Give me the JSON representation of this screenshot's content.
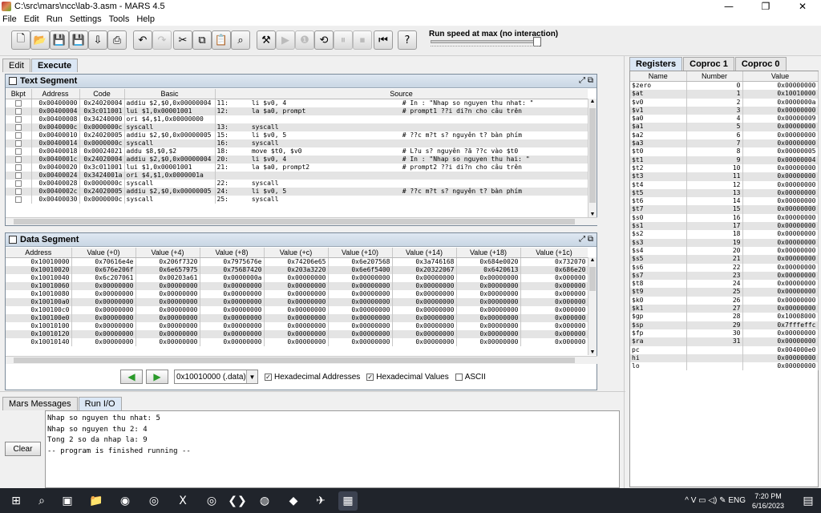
{
  "window": {
    "title": "C:\\src\\mars\\ncc\\lab-3.asm  - MARS 4.5",
    "minimize": "—",
    "maximize": "❐",
    "close": "✕"
  },
  "menu": [
    "File",
    "Edit",
    "Run",
    "Settings",
    "Tools",
    "Help"
  ],
  "toolbar": {
    "buttons": [
      {
        "name": "new-file-icon",
        "glyph": "🗋",
        "enabled": true
      },
      {
        "name": "open-file-icon",
        "glyph": "📂",
        "enabled": true
      },
      {
        "name": "save-file-icon",
        "glyph": "💾",
        "enabled": true
      },
      {
        "name": "save-as-icon",
        "glyph": "💾",
        "enabled": true
      },
      {
        "name": "dump-memory-icon",
        "glyph": "⇩",
        "enabled": true
      },
      {
        "name": "print-icon",
        "glyph": "⎙",
        "enabled": true
      },
      {
        "name": "undo-icon",
        "glyph": "↶",
        "enabled": true
      },
      {
        "name": "redo-icon",
        "glyph": "↷",
        "enabled": false
      },
      {
        "name": "cut-icon",
        "glyph": "✂",
        "enabled": true
      },
      {
        "name": "copy-icon",
        "glyph": "⧉",
        "enabled": true
      },
      {
        "name": "paste-icon",
        "glyph": "📋",
        "enabled": true
      },
      {
        "name": "find-replace-icon",
        "glyph": "⌕",
        "enabled": true
      },
      {
        "name": "assemble-icon",
        "glyph": "⚒",
        "enabled": true
      },
      {
        "name": "run-icon",
        "glyph": "▶",
        "enabled": false
      },
      {
        "name": "step-icon",
        "glyph": "❶",
        "enabled": false
      },
      {
        "name": "backstep-icon",
        "glyph": "⟲",
        "enabled": true
      },
      {
        "name": "pause-icon",
        "glyph": "⏸",
        "enabled": false
      },
      {
        "name": "stop-icon",
        "glyph": "⏹",
        "enabled": false
      },
      {
        "name": "reset-icon",
        "glyph": "⏮",
        "enabled": true
      },
      {
        "name": "help-icon",
        "glyph": "?",
        "enabled": true
      }
    ],
    "speed_label": "Run speed at max (no interaction)"
  },
  "main_tabs": [
    "Edit",
    "Execute"
  ],
  "text_segment": {
    "title": "Text Segment",
    "columns": [
      "Bkpt",
      "Address",
      "Code",
      "Basic",
      "Source"
    ],
    "rows": [
      [
        "0x00400000",
        "0x24020004",
        "addiu $2,$0,0x00000004",
        "11:      li $v0, 4                              # In : \"Nhap so nguyen thu nhat: \""
      ],
      [
        "0x00400004",
        "0x3c011001",
        "lui $1,0x00001001",
        "12:      la $a0, prompt                         # prompt1 ??i di?n cho câu trên"
      ],
      [
        "0x00400008",
        "0x34240000",
        "ori $4,$1,0x00000000",
        ""
      ],
      [
        "0x0040000c",
        "0x0000000c",
        "syscall",
        "13:      syscall"
      ],
      [
        "0x00400010",
        "0x24020005",
        "addiu $2,$0,0x00000005",
        "15:      li $v0, 5                              # ??c m?t s? nguyên t? bàn phím"
      ],
      [
        "0x00400014",
        "0x0000000c",
        "syscall",
        "16:      syscall"
      ],
      [
        "0x00400018",
        "0x00024021",
        "addu $8,$0,$2",
        "18:      move $t0, $v0                          # L?u s? nguyên ?ã ??c vào $t0"
      ],
      [
        "0x0040001c",
        "0x24020004",
        "addiu $2,$0,0x00000004",
        "20:      li $v0, 4                              # In : \"Nhap so nguyen thu hai: \""
      ],
      [
        "0x00400020",
        "0x3c011001",
        "lui $1,0x00001001",
        "21:      la $a0, prompt2                        # prompt2 ??i di?n cho câu trên"
      ],
      [
        "0x00400024",
        "0x3424001a",
        "ori $4,$1,0x0000001a",
        ""
      ],
      [
        "0x00400028",
        "0x0000000c",
        "syscall",
        "22:      syscall"
      ],
      [
        "0x0040002c",
        "0x24020005",
        "addiu $2,$0,0x00000005",
        "24:      li $v0, 5                              # ??c m?t s? nguyên t? bàn phím"
      ],
      [
        "0x00400030",
        "0x0000000c",
        "syscall",
        "25:      syscall"
      ]
    ]
  },
  "data_segment": {
    "title": "Data Segment",
    "columns": [
      "Address",
      "Value (+0)",
      "Value (+4)",
      "Value (+8)",
      "Value (+c)",
      "Value (+10)",
      "Value (+14)",
      "Value (+18)",
      "Value (+1c)"
    ],
    "rows": [
      [
        "0x10010000",
        "0x70616e4e",
        "0x206f7320",
        "0x7975676e",
        "0x74206e65",
        "0x6e207568",
        "0x3a746168",
        "0x684e0020",
        "0x732070"
      ],
      [
        "0x10010020",
        "0x676e206f",
        "0x6e657975",
        "0x75687420",
        "0x203a3220",
        "0x6e6f5400",
        "0x20322067",
        "0x6420613",
        "0x686e20"
      ],
      [
        "0x10010040",
        "0x6c207061",
        "0x00203a61",
        "0x0000000a",
        "0x00000000",
        "0x00000000",
        "0x00000000",
        "0x00000000",
        "0x000000"
      ],
      [
        "0x10010060",
        "0x00000000",
        "0x00000000",
        "0x00000000",
        "0x00000000",
        "0x00000000",
        "0x00000000",
        "0x00000000",
        "0x000000"
      ],
      [
        "0x10010080",
        "0x00000000",
        "0x00000000",
        "0x00000000",
        "0x00000000",
        "0x00000000",
        "0x00000000",
        "0x00000000",
        "0x000000"
      ],
      [
        "0x100100a0",
        "0x00000000",
        "0x00000000",
        "0x00000000",
        "0x00000000",
        "0x00000000",
        "0x00000000",
        "0x00000000",
        "0x000000"
      ],
      [
        "0x100100c0",
        "0x00000000",
        "0x00000000",
        "0x00000000",
        "0x00000000",
        "0x00000000",
        "0x00000000",
        "0x00000000",
        "0x000000"
      ],
      [
        "0x100100e0",
        "0x00000000",
        "0x00000000",
        "0x00000000",
        "0x00000000",
        "0x00000000",
        "0x00000000",
        "0x00000000",
        "0x000000"
      ],
      [
        "0x10010100",
        "0x00000000",
        "0x00000000",
        "0x00000000",
        "0x00000000",
        "0x00000000",
        "0x00000000",
        "0x00000000",
        "0x000000"
      ],
      [
        "0x10010120",
        "0x00000000",
        "0x00000000",
        "0x00000000",
        "0x00000000",
        "0x00000000",
        "0x00000000",
        "0x00000000",
        "0x000000"
      ],
      [
        "0x10010140",
        "0x00000000",
        "0x00000000",
        "0x00000000",
        "0x00000000",
        "0x00000000",
        "0x00000000",
        "0x00000000",
        "0x000000"
      ]
    ],
    "nav_prev": "◀",
    "nav_next": "▶",
    "segment_select": "0x10010000 (.data)",
    "hex_addresses_label": "Hexadecimal Addresses",
    "hex_addresses_checked": true,
    "hex_values_label": "Hexadecimal Values",
    "hex_values_checked": true,
    "ascii_label": "ASCII",
    "ascii_checked": false
  },
  "bottom_tabs": [
    "Mars Messages",
    "Run I/O"
  ],
  "run_io": {
    "lines": [
      "Nhap so nguyen thu nhat: 5",
      "Nhap so nguyen thu 2: 4",
      "Tong 2 so da nhap la: 9",
      "-- program is finished running --"
    ],
    "clear_label": "Clear"
  },
  "reg_tabs": [
    "Registers",
    "Coproc 1",
    "Coproc 0"
  ],
  "registers": {
    "columns": [
      "Name",
      "Number",
      "Value"
    ],
    "rows": [
      [
        "$zero",
        "0",
        "0x00000000"
      ],
      [
        "$at",
        "1",
        "0x10010000"
      ],
      [
        "$v0",
        "2",
        "0x0000000a"
      ],
      [
        "$v1",
        "3",
        "0x00000000"
      ],
      [
        "$a0",
        "4",
        "0x00000009"
      ],
      [
        "$a1",
        "5",
        "0x00000000"
      ],
      [
        "$a2",
        "6",
        "0x00000000"
      ],
      [
        "$a3",
        "7",
        "0x00000000"
      ],
      [
        "$t0",
        "8",
        "0x00000005"
      ],
      [
        "$t1",
        "9",
        "0x00000004"
      ],
      [
        "$t2",
        "10",
        "0x00000000"
      ],
      [
        "$t3",
        "11",
        "0x00000000"
      ],
      [
        "$t4",
        "12",
        "0x00000000"
      ],
      [
        "$t5",
        "13",
        "0x00000000"
      ],
      [
        "$t6",
        "14",
        "0x00000000"
      ],
      [
        "$t7",
        "15",
        "0x00000000"
      ],
      [
        "$s0",
        "16",
        "0x00000000"
      ],
      [
        "$s1",
        "17",
        "0x00000000"
      ],
      [
        "$s2",
        "18",
        "0x00000000"
      ],
      [
        "$s3",
        "19",
        "0x00000000"
      ],
      [
        "$s4",
        "20",
        "0x00000000"
      ],
      [
        "$s5",
        "21",
        "0x00000000"
      ],
      [
        "$s6",
        "22",
        "0x00000000"
      ],
      [
        "$s7",
        "23",
        "0x00000000"
      ],
      [
        "$t8",
        "24",
        "0x00000000"
      ],
      [
        "$t9",
        "25",
        "0x00000000"
      ],
      [
        "$k0",
        "26",
        "0x00000000"
      ],
      [
        "$k1",
        "27",
        "0x00000000"
      ],
      [
        "$gp",
        "28",
        "0x10008000"
      ],
      [
        "$sp",
        "29",
        "0x7fffeffc"
      ],
      [
        "$fp",
        "30",
        "0x00000000"
      ],
      [
        "$ra",
        "31",
        "0x00000000"
      ],
      [
        "pc",
        "",
        "0x004000e0"
      ],
      [
        "hi",
        "",
        "0x00000000"
      ],
      [
        "lo",
        "",
        "0x00000000"
      ]
    ]
  },
  "taskbar": {
    "start": "⊞",
    "apps": [
      "⌕",
      "▣",
      "📁",
      "◉",
      "◎",
      "X",
      "◎",
      "❮❯",
      "◍",
      "◆",
      "✈",
      "▦"
    ],
    "tray": "^  V  ▭  ◁)  ✎  ENG",
    "time": "7:20 PM",
    "date": "6/16/2023",
    "notify": "▤"
  },
  "colors": {
    "panel_header": "#c9d6e4",
    "row_alt": "#e4e4e4",
    "taskbar": "#20242b",
    "nav_arrow": "#2a9a2a"
  }
}
